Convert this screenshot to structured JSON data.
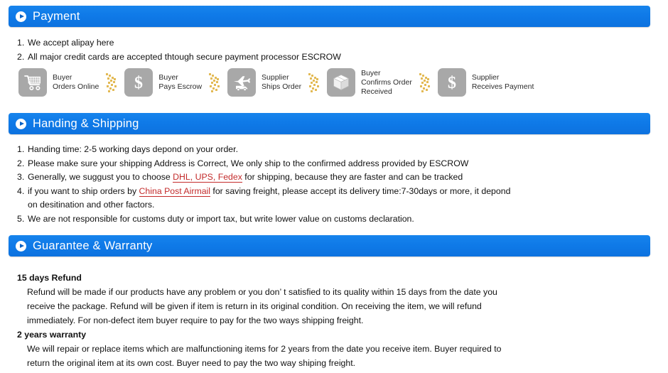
{
  "sections": [
    {
      "id": "payment",
      "title": "Payment",
      "icon": "play-circle-icon"
    },
    {
      "id": "handling-shipping",
      "title": "Handing & Shipping",
      "icon": "play-circle-icon"
    },
    {
      "id": "guarantee-warranty",
      "title": "Guarantee & Warranty",
      "icon": "play-circle-icon"
    }
  ],
  "payment": {
    "items": [
      {
        "num": "1.",
        "text": "We  accept alipay here"
      },
      {
        "num": "2.",
        "text": "All major credit cards are accepted thtough secure payment processor ESCROW"
      }
    ],
    "flow": [
      {
        "icon": "shopping-cart-icon",
        "line1": "Buyer",
        "line2": "Orders Online",
        "line3": ""
      },
      {
        "icon": "dollar-sign-icon",
        "line1": "Buyer",
        "line2": "Pays Escrow",
        "line3": ""
      },
      {
        "icon": "airplane-truck-icon",
        "line1": "Supplier",
        "line2": "Ships Order",
        "line3": ""
      },
      {
        "icon": "package-box-icon",
        "line1": "Buyer",
        "line2": "Confirms Order",
        "line3": "Received"
      },
      {
        "icon": "dollar-sign-icon",
        "line1": "Supplier",
        "line2": "Receives Payment",
        "line3": ""
      }
    ],
    "arrow_icon": "dotted-chevron-right-icon"
  },
  "shipping": {
    "items": [
      {
        "num": "1.",
        "pre": "Handing time: 2-5 working days depond on your order.",
        "link": "",
        "post": ""
      },
      {
        "num": "2.",
        "pre": "Please make sure your shipping Address is Correct, We only ship to the confirmed address provided  by ESCROW",
        "link": "",
        "post": ""
      },
      {
        "num": "3.",
        "pre": "Generally, we suggust you to choose ",
        "link": "DHL, UPS, Fedex",
        "post": " for shipping, because they are faster and can be tracked"
      },
      {
        "num": "4.",
        "pre": "if you want to ship orders by ",
        "link": "China Post Airmail",
        "post": " for saving freight, please accept its delivery time:7-30days or more, it depond",
        "wrap": "on desitination and other factors."
      },
      {
        "num": "5.",
        "pre": "We are not responsible for customs duty or import tax, but write lower value on customs declaration.",
        "link": "",
        "post": ""
      }
    ]
  },
  "warranty": {
    "blocks": [
      {
        "heading": "15 days Refund",
        "lines": [
          "Refund will be made if our products have any problem or you don’ t satisfied to its quality within 15 days from the date you",
          "receive the package. Refund will be given if item is return in its original condition. On receiving the item, we will refund",
          "immediately. For non-defect item buyer require to pay for the two ways shipping freight."
        ]
      },
      {
        "heading": "2 years warranty",
        "lines": [
          "We will repair or replace items which are malfunctioning items for 2 years from the date you receive item. Buyer required to",
          "return the original item at its own cost. Buyer need to pay the two way shiping freight."
        ]
      }
    ]
  },
  "colors": {
    "bar_blue": "#0f7ae8",
    "link_red": "#c32b2b",
    "badge_gray": "#a8a8a8",
    "arrow_gold": "#e8c360"
  }
}
